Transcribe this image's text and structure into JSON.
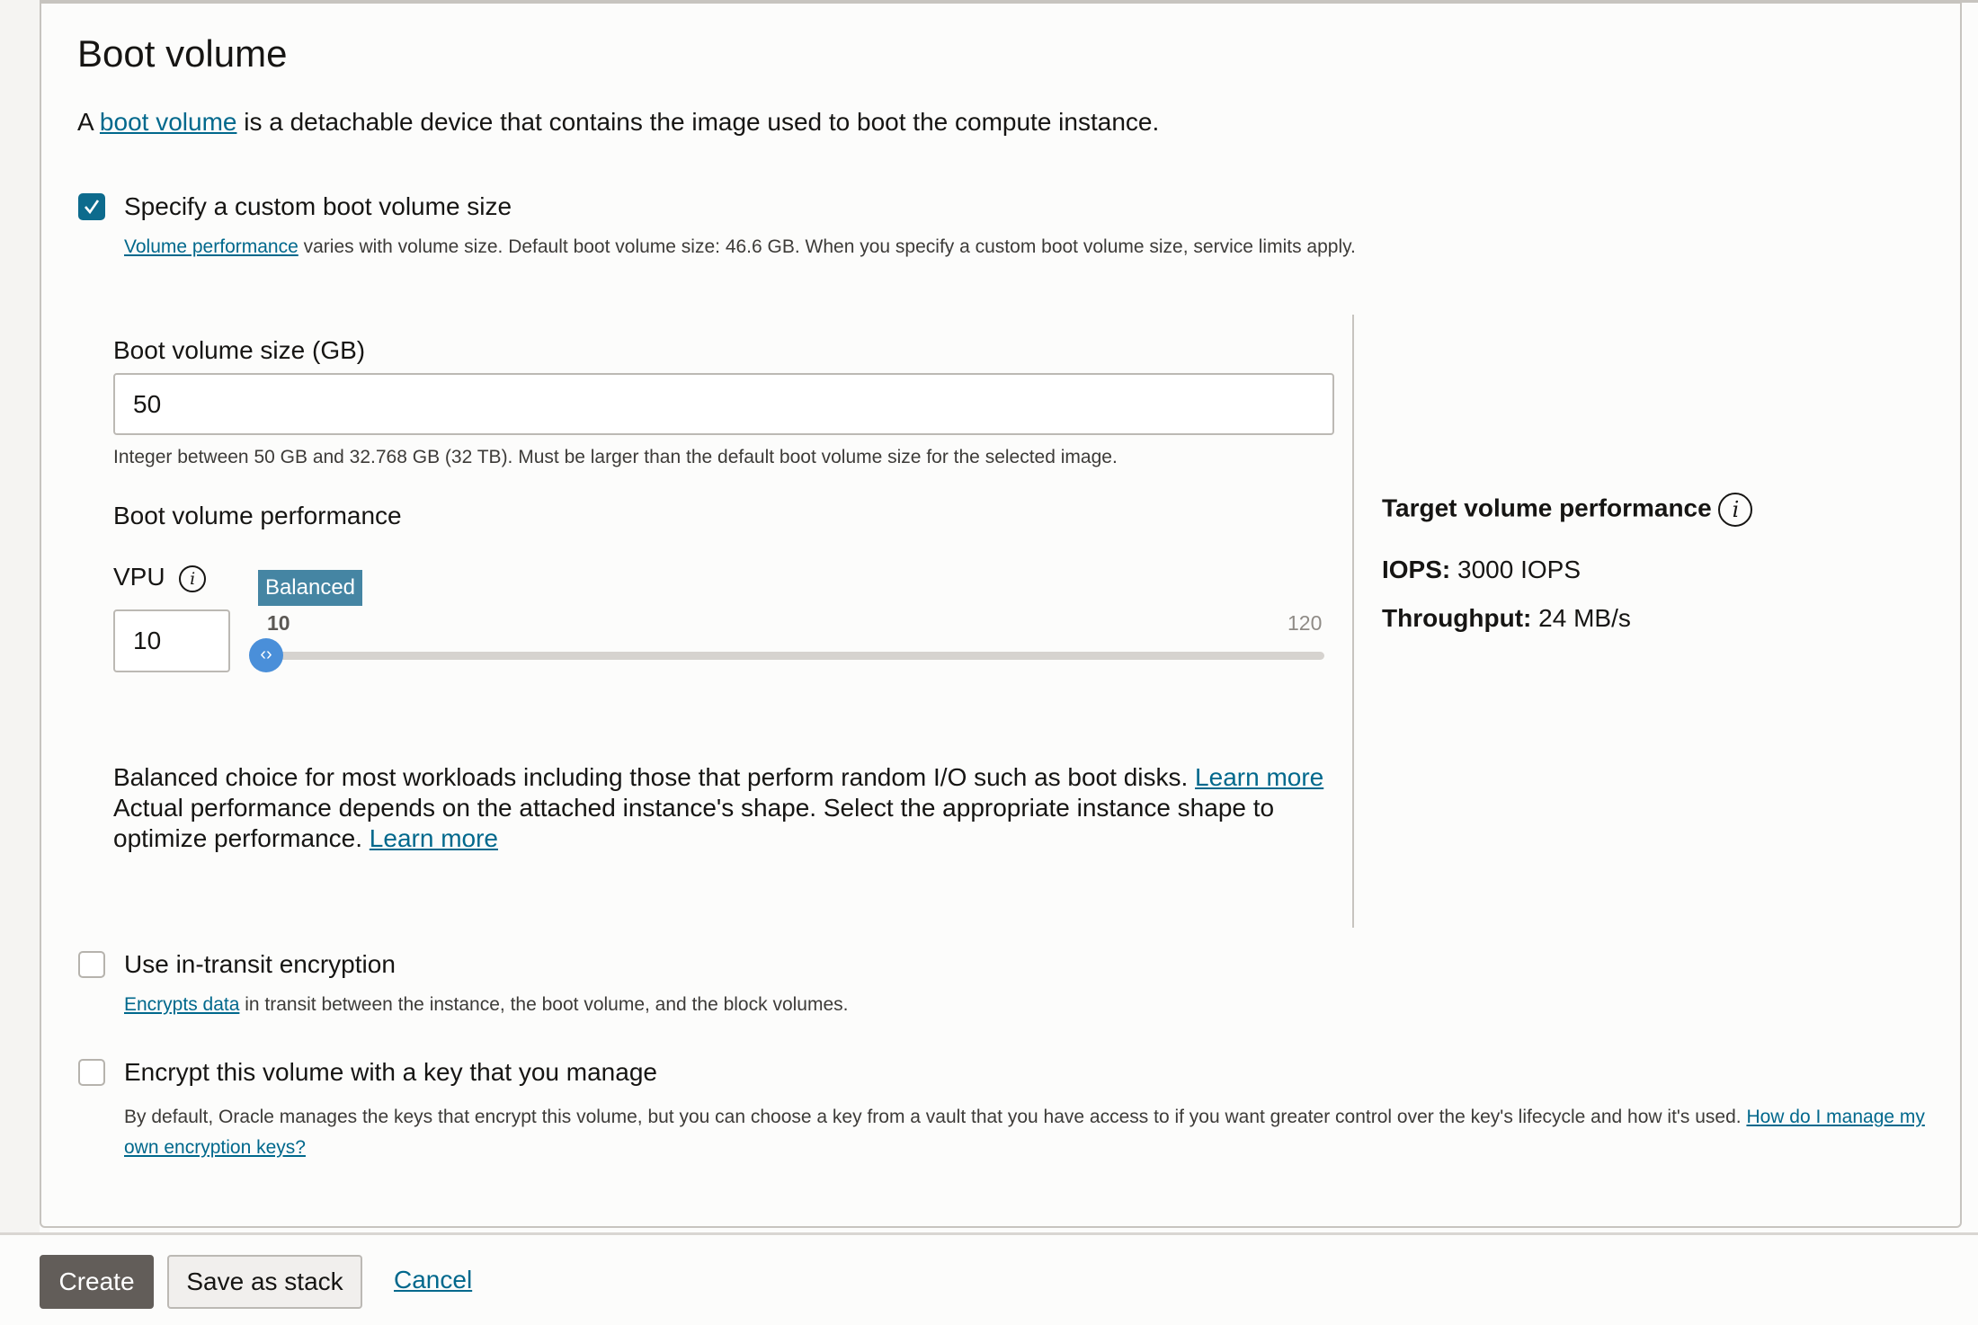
{
  "section": {
    "title": "Boot volume",
    "description_prefix": "A ",
    "description_link": "boot volume",
    "description_suffix": " is a detachable device that contains the image used to boot the compute instance."
  },
  "custom_size": {
    "label": "Specify a custom boot volume size",
    "checked": true,
    "help_link": "Volume performance",
    "help_text": " varies with volume size. Default boot volume size: 46.6 GB. When you specify a custom boot volume size, service limits apply."
  },
  "size_field": {
    "label": "Boot volume size (GB)",
    "value": "50",
    "hint": "Integer between 50 GB and 32.768 GB (32 TB). Must be larger than the default boot volume size for the selected image."
  },
  "performance": {
    "heading": "Boot volume performance",
    "vpu_label": "VPU",
    "vpu_value": "10",
    "tag": "Balanced",
    "slider": {
      "min": 10,
      "max": 120,
      "value": 10,
      "min_label": "10",
      "max_label": "120"
    },
    "text1": "Balanced choice for most workloads including those that perform random I/O such as boot disks. ",
    "link1": "Learn more",
    "text2": "Actual performance depends on the attached instance's shape. Select the appropriate instance shape to optimize performance. ",
    "link2": "Learn more"
  },
  "target": {
    "title": "Target volume performance",
    "iops_label": "IOPS:",
    "iops_value": " 3000 IOPS",
    "throughput_label": "Throughput:",
    "throughput_value": " 24 MB/s"
  },
  "in_transit": {
    "label": "Use in-transit encryption",
    "checked": false,
    "help_link": "Encrypts data",
    "help_text": " in transit between the instance, the boot volume, and the block volumes."
  },
  "own_key": {
    "label": "Encrypt this volume with a key that you manage",
    "checked": false,
    "help_text": "By default, Oracle manages the keys that encrypt this volume, but you can choose a key from a vault that you have access to if you want greater control over the key's lifecycle and how it's used. ",
    "help_link": "How do I manage my own encryption keys?"
  },
  "footer": {
    "create": "Create",
    "save_stack": "Save as stack",
    "cancel": "Cancel"
  },
  "colors": {
    "accent": "#0d6b8d",
    "link": "#00688c",
    "tag": "#4585a3",
    "handle": "#4a8fd9",
    "primary_button": "#625d59"
  }
}
